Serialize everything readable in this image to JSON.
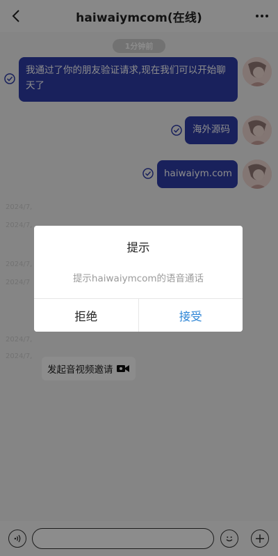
{
  "header": {
    "title": "haiwaiymcom(在线)",
    "back_icon": "chevron-left-icon",
    "more_icon": "more-dots-icon"
  },
  "chat": {
    "time_label": "1分钟前",
    "messages": [
      {
        "text": "我通过了你的朋友验证请求,现在我们可以开始聊天了",
        "status": "read"
      },
      {
        "text": "海外源码",
        "status": "read"
      },
      {
        "text": "haiwaiym.com",
        "status": "read"
      }
    ],
    "timestamps": [
      "2024/7,",
      "2024/7,",
      "2024/7,",
      "2024/7",
      "2024/7,",
      "2024/7,"
    ],
    "video_invite_text": "发起音视频邀请"
  },
  "dialog": {
    "title": "提示",
    "message": "提示haiwaiymcom的语音通话",
    "reject_label": "拒绝",
    "accept_label": "接受",
    "accept_color": "#2f86d6"
  },
  "toolbar": {
    "voice_icon": "voice-icon",
    "input_placeholder": "",
    "emoji_icon": "emoji-icon",
    "add_icon": "plus-icon"
  },
  "colors": {
    "bubble": "#2f3ca8",
    "overlay": "rgba(0,0,0,0.45)"
  }
}
